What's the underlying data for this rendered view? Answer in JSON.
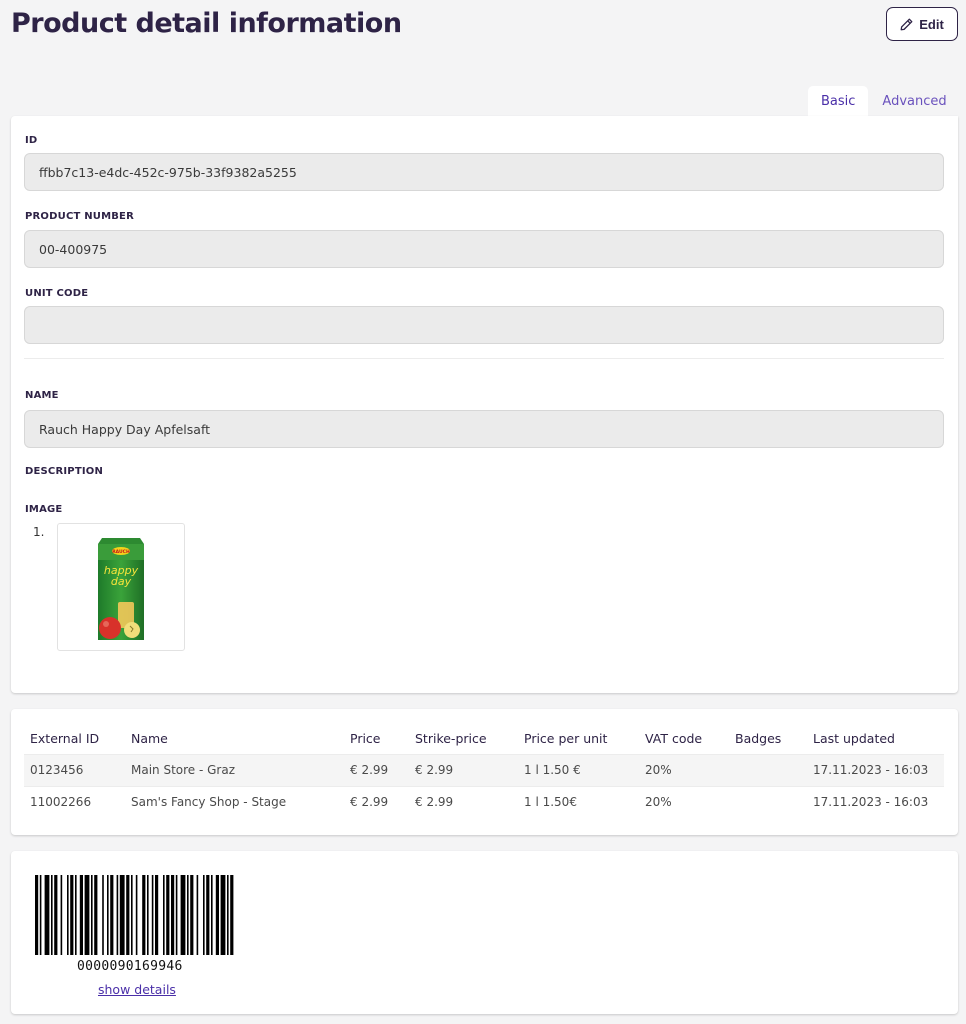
{
  "header": {
    "title": "Product detail information",
    "edit_label": "Edit"
  },
  "tabs": [
    {
      "label": "Basic",
      "active": true
    },
    {
      "label": "Advanced",
      "active": false
    }
  ],
  "fields": {
    "id": {
      "label": "ID",
      "value": "ffbb7c13-e4dc-452c-975b-33f9382a5255"
    },
    "product_number": {
      "label": "PRODUCT NUMBER",
      "value": "00-400975"
    },
    "unit_code": {
      "label": "UNIT CODE",
      "value": ""
    },
    "name": {
      "label": "NAME",
      "value": "Rauch Happy Day Apfelsaft"
    },
    "description": {
      "label": "DESCRIPTION",
      "value": ""
    },
    "image": {
      "label": "IMAGE",
      "index": "1.",
      "brand_text": "RAUCH",
      "product_text": "happy day"
    }
  },
  "prices_table": {
    "columns": [
      "External ID",
      "Name",
      "Price",
      "Strike-price",
      "Price per unit",
      "VAT code",
      "Badges",
      "Last updated"
    ],
    "rows": [
      [
        "0123456",
        "Main Store - Graz",
        "€ 2.99",
        "€ 2.99",
        "1 l 1.50 €",
        "20%",
        "",
        "17.11.2023 - 16:03"
      ],
      [
        "11002266",
        "Sam's Fancy Shop - Stage",
        "€ 2.99",
        "€ 2.99",
        "1 l 1.50€",
        "20%",
        "",
        "17.11.2023 - 16:03"
      ]
    ]
  },
  "barcode": {
    "number": "0000090169946",
    "link_label": "show details"
  },
  "colors": {
    "accent": "#4a2fa8",
    "title": "#2e2346",
    "background": "#f4f4f5"
  }
}
